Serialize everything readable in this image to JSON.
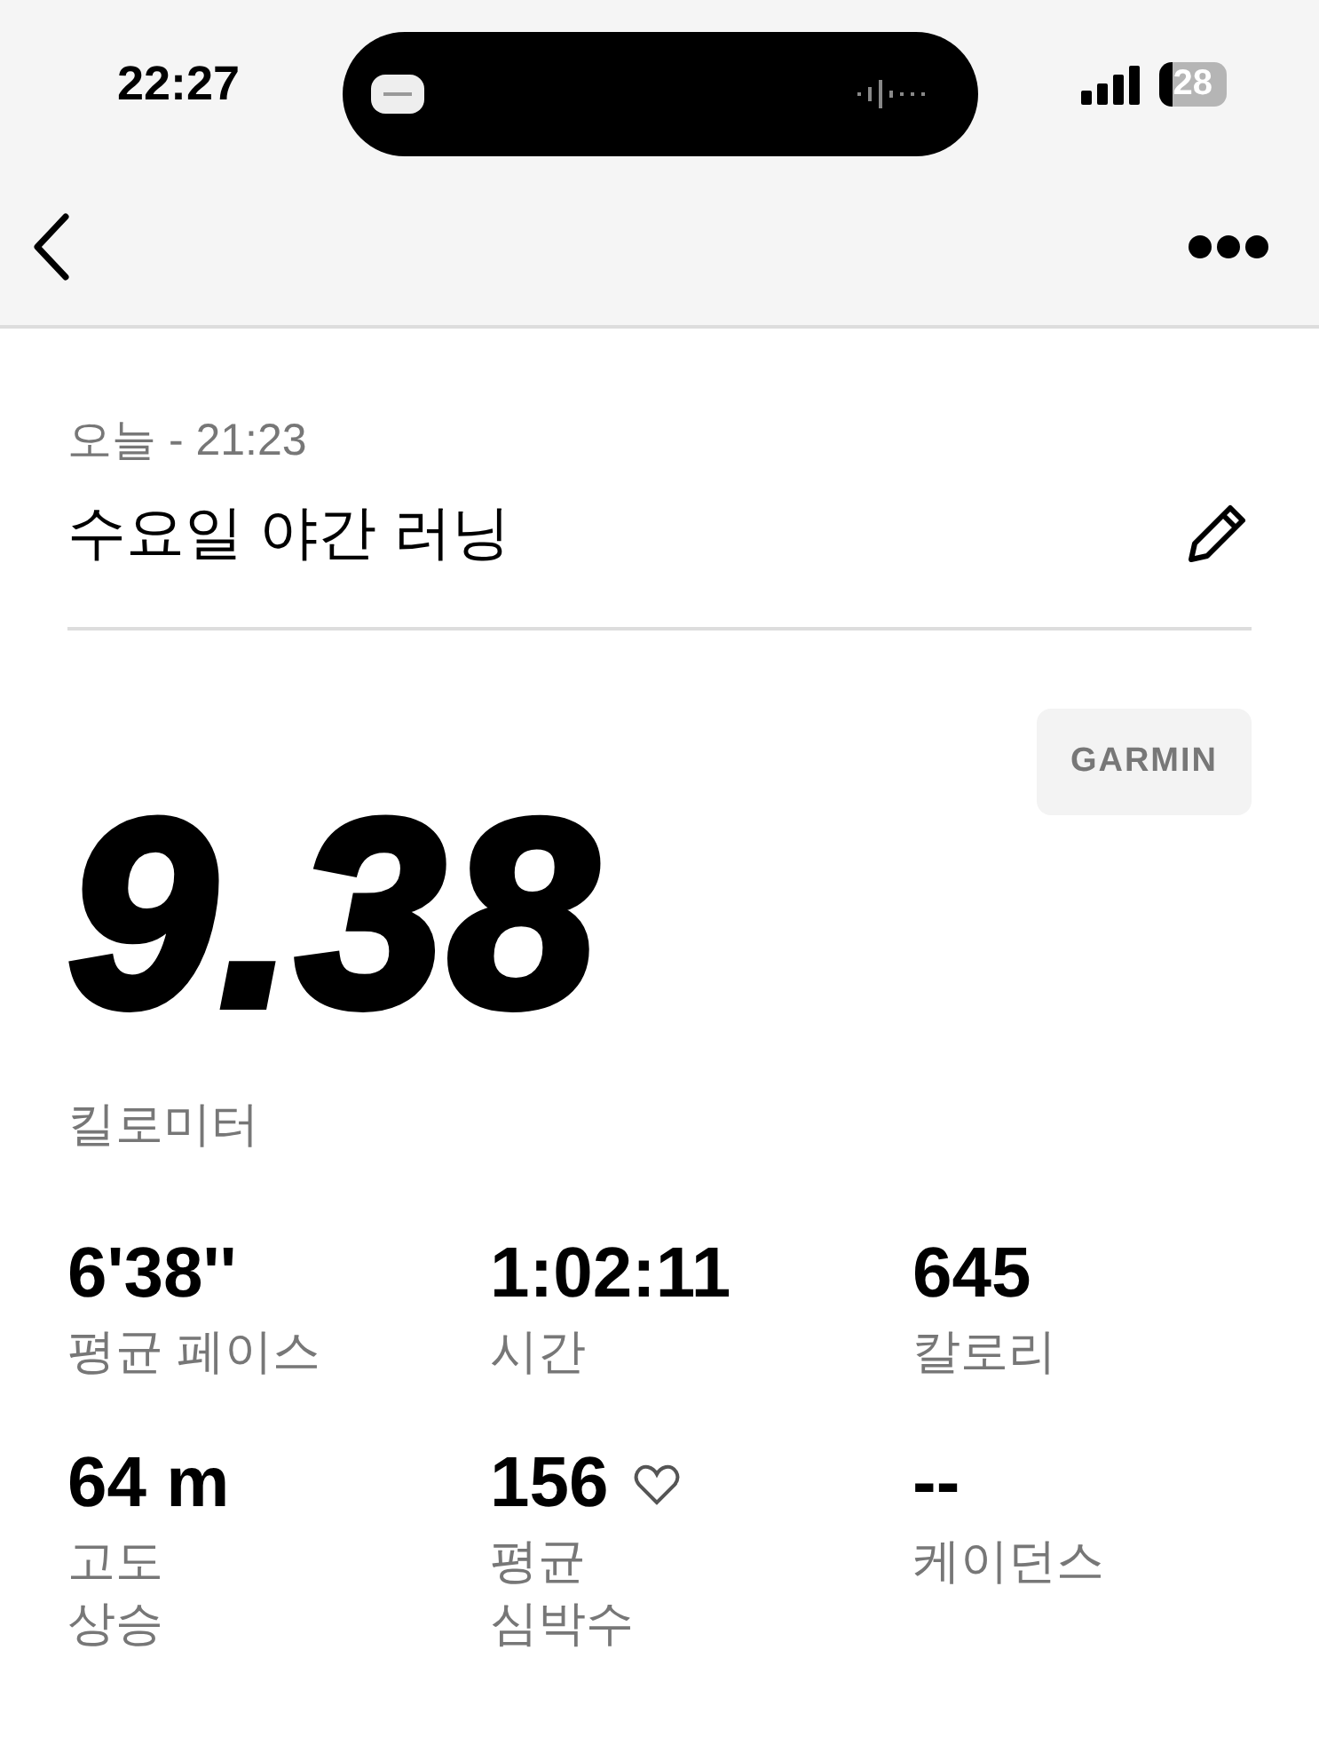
{
  "status_bar": {
    "time": "22:27",
    "battery": "28"
  },
  "activity": {
    "date": "오늘 - 21:23",
    "title": "수요일 야간 러닝",
    "source": "GARMIN",
    "distance": "9.38",
    "unit": "킬로미터"
  },
  "stats": [
    {
      "value": "6'38''",
      "label": "평균 페이스",
      "heart": false
    },
    {
      "value": "1:02:11",
      "label": "시간",
      "heart": false
    },
    {
      "value": "645",
      "label": "칼로리",
      "heart": false
    },
    {
      "value": "64 m",
      "label": "고도\n상승",
      "heart": false
    },
    {
      "value": "156",
      "label": "평균\n심박수",
      "heart": true
    },
    {
      "value": "--",
      "label": "케이던스",
      "heart": false
    }
  ]
}
